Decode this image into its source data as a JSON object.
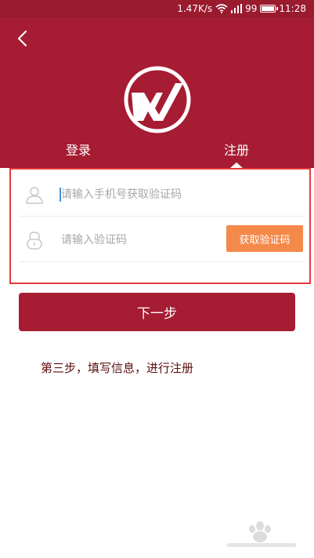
{
  "status_bar": {
    "net_speed": "1.47K/s",
    "signal_text": "99",
    "time": "11:28"
  },
  "tabs": {
    "login": "登录",
    "register": "注册"
  },
  "form": {
    "phone_placeholder": "请输入手机号获取验证码",
    "code_placeholder": "请输入验证码",
    "get_code_button": "获取验证码"
  },
  "next_button": "下一步",
  "caption": "第三步，填写信息，进行注册",
  "colors": {
    "header": "#a61c33",
    "status_bar": "#9a1a2e",
    "highlight_border": "#e8393a",
    "get_code_button": "#f5894a",
    "caption_text": "#5a0e0e"
  },
  "icons": [
    "back-arrow-icon",
    "wifi-icon",
    "signal-icon",
    "battery-icon",
    "wps-logo",
    "user-icon",
    "lock-icon",
    "watermark"
  ]
}
